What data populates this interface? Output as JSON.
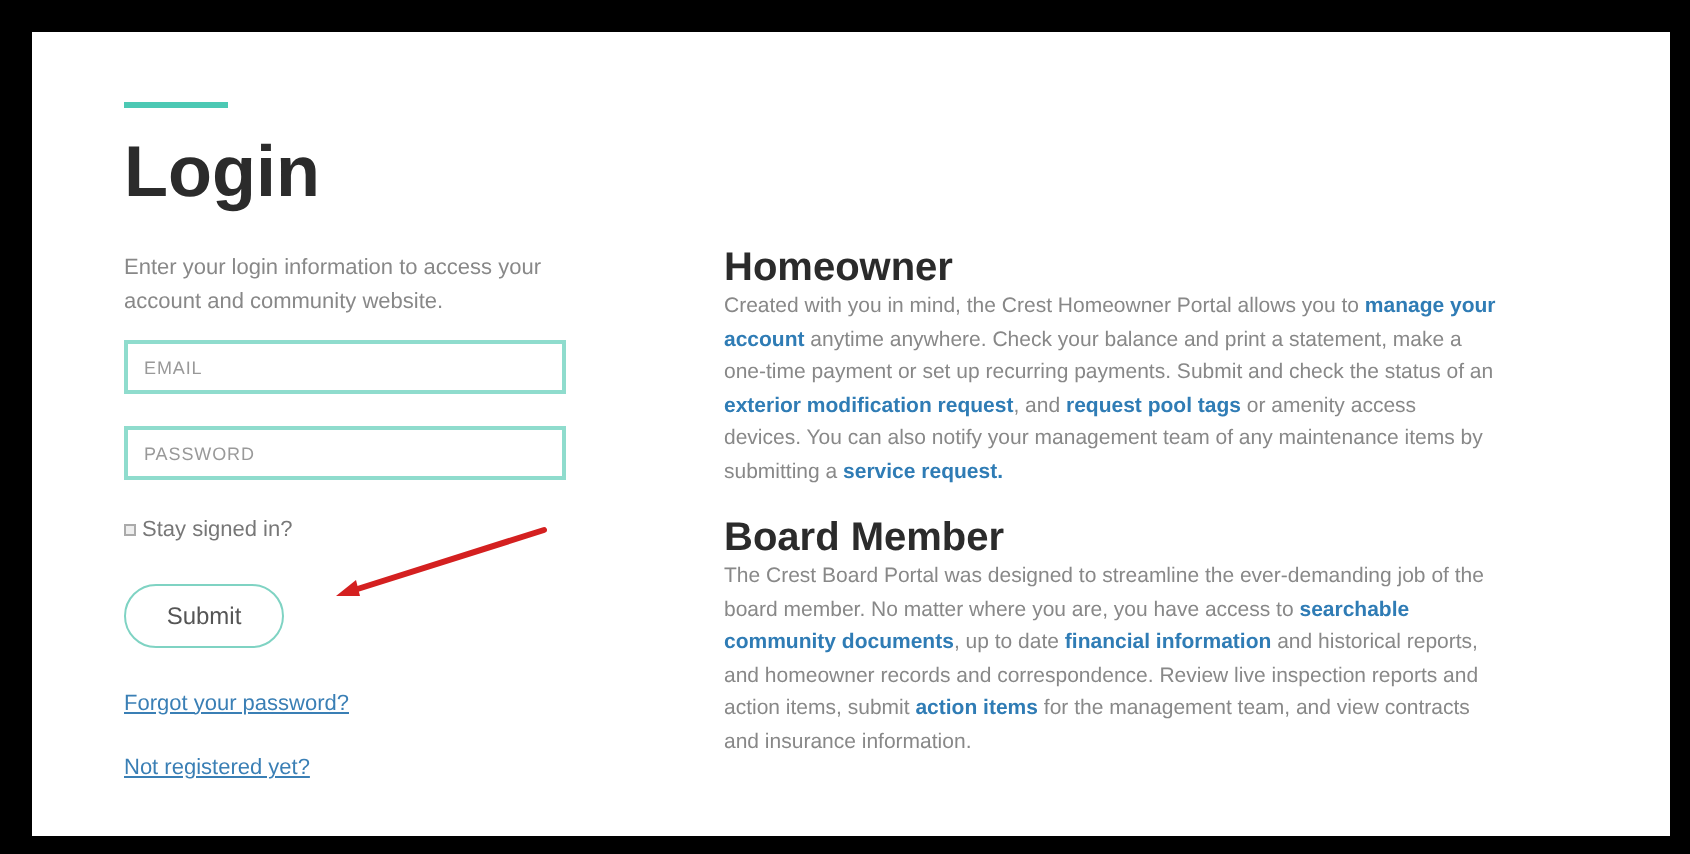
{
  "login": {
    "title": "Login",
    "intro": "Enter your login information to access your account and community website.",
    "email": {
      "placeholder": "EMAIL"
    },
    "password": {
      "placeholder": "PASSWORD"
    },
    "stay_signed_in": {
      "label": "Stay signed in?",
      "checked": false
    },
    "submit": "Submit",
    "links": [
      "Forgot your password?",
      "Not registered yet?"
    ]
  },
  "sections": [
    {
      "title": "Homeowner",
      "text": "Created with you in mind, the Crest Homeowner Portal allows you to **manage your account** anytime anywhere. Check your balance and print a statement, make a one-time payment or set up recurring payments. Submit and check the status of an **exterior modification request**, and **request pool tags** or amenity access devices. You can also notify your management team of any maintenance items by submitting a **service request.**"
    },
    {
      "title": "Board Member",
      "text": "The Crest Board Portal was designed to streamline the ever-demanding job of the board member. No matter where you are, you have access to **searchable community documents**, up to date **financial information** and historical reports, and homeowner records and correspondence. Review live inspection reports and action items, submit **action items** for the management team, and view contracts and insurance information."
    }
  ]
}
